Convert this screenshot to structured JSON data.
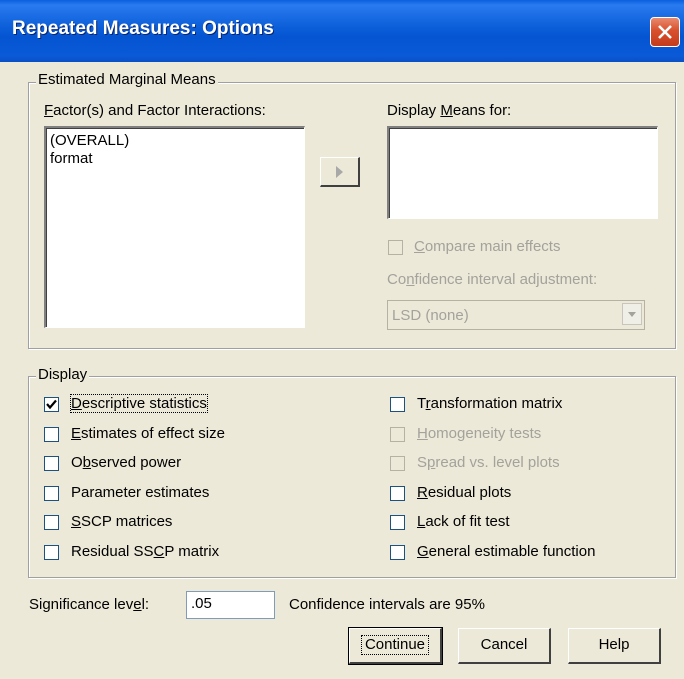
{
  "window": {
    "title": "Repeated Measures: Options"
  },
  "emm": {
    "group_label": "Estimated Marginal Means",
    "factors_label": "Factor(s) and Factor Interactions:",
    "factors_items": [
      "(OVERALL)",
      "format"
    ],
    "display_means_label": "Display Means for:",
    "display_means_items": [],
    "compare_main_effects": {
      "label": "Compare main effects",
      "checked": false,
      "enabled": false
    },
    "ci_adjustment_label": "Confidence interval adjustment:",
    "ci_adjustment_value": "LSD (none)"
  },
  "display": {
    "group_label": "Display",
    "left": [
      {
        "label": "Descriptive statistics",
        "checked": true,
        "enabled": true
      },
      {
        "label": "Estimates of effect size",
        "checked": false,
        "enabled": true
      },
      {
        "label": "Observed power",
        "checked": false,
        "enabled": true
      },
      {
        "label": "Parameter estimates",
        "checked": false,
        "enabled": true
      },
      {
        "label": "SSCP matrices",
        "checked": false,
        "enabled": true
      },
      {
        "label": "Residual SSCP matrix",
        "checked": false,
        "enabled": true
      }
    ],
    "right": [
      {
        "label": "Transformation matrix",
        "checked": false,
        "enabled": true
      },
      {
        "label": "Homogeneity tests",
        "checked": false,
        "enabled": false
      },
      {
        "label": "Spread vs. level plots",
        "checked": false,
        "enabled": false
      },
      {
        "label": "Residual plots",
        "checked": false,
        "enabled": true
      },
      {
        "label": "Lack of fit test",
        "checked": false,
        "enabled": true
      },
      {
        "label": "General estimable function",
        "checked": false,
        "enabled": true
      }
    ]
  },
  "significance": {
    "label": "Significance level:",
    "value": ".05",
    "ci_text": "Confidence intervals are 95%"
  },
  "buttons": {
    "continue": "Continue",
    "cancel": "Cancel",
    "help": "Help"
  },
  "colors": {
    "titlebar": "#0554d2",
    "close": "#d8502e",
    "face": "#ece9d8",
    "disabled_text": "#a3a29b"
  }
}
